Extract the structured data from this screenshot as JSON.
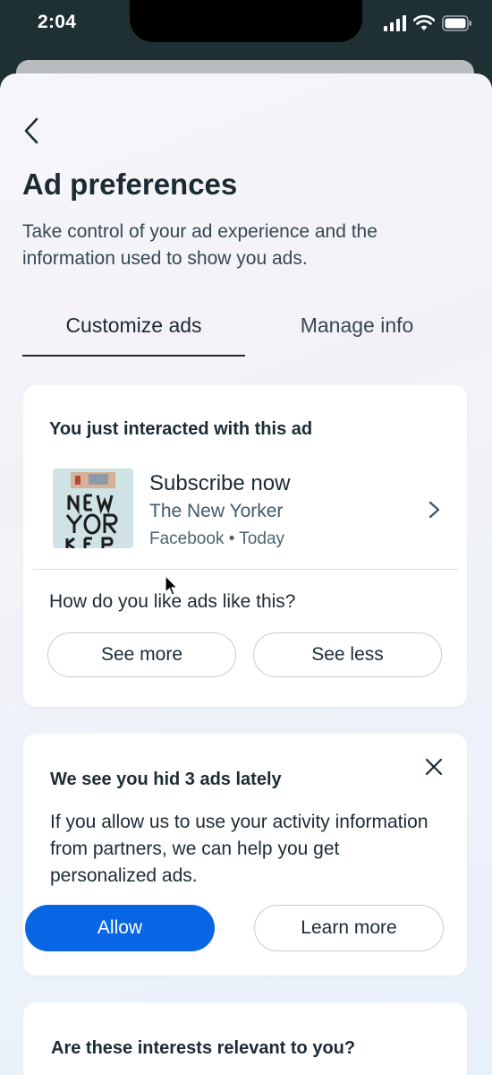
{
  "status_bar": {
    "time": "2:04"
  },
  "header": {
    "title": "Ad preferences",
    "subtitle": "Take control of your ad experience and the information used to show you ads."
  },
  "tabs": [
    {
      "label": "Customize ads",
      "active": true
    },
    {
      "label": "Manage info",
      "active": false
    }
  ],
  "recent_ad": {
    "heading": "You just interacted with this ad",
    "title": "Subscribe now",
    "advertiser": "The New Yorker",
    "meta": "Facebook • Today",
    "question": "How do you like ads like this?",
    "see_more_label": "See more",
    "see_less_label": "See less"
  },
  "hidden_ads": {
    "heading": "We see you hid 3 ads lately",
    "body": "If you allow us to use your activity information from partners, we can help you get personalized ads.",
    "allow_label": "Allow",
    "learn_more_label": "Learn more"
  },
  "interests": {
    "heading": "Are these interests relevant to you?"
  },
  "colors": {
    "primary_button": "#0866e5",
    "status_bar_bg": "#1f3035",
    "text": "#1c2b33"
  }
}
